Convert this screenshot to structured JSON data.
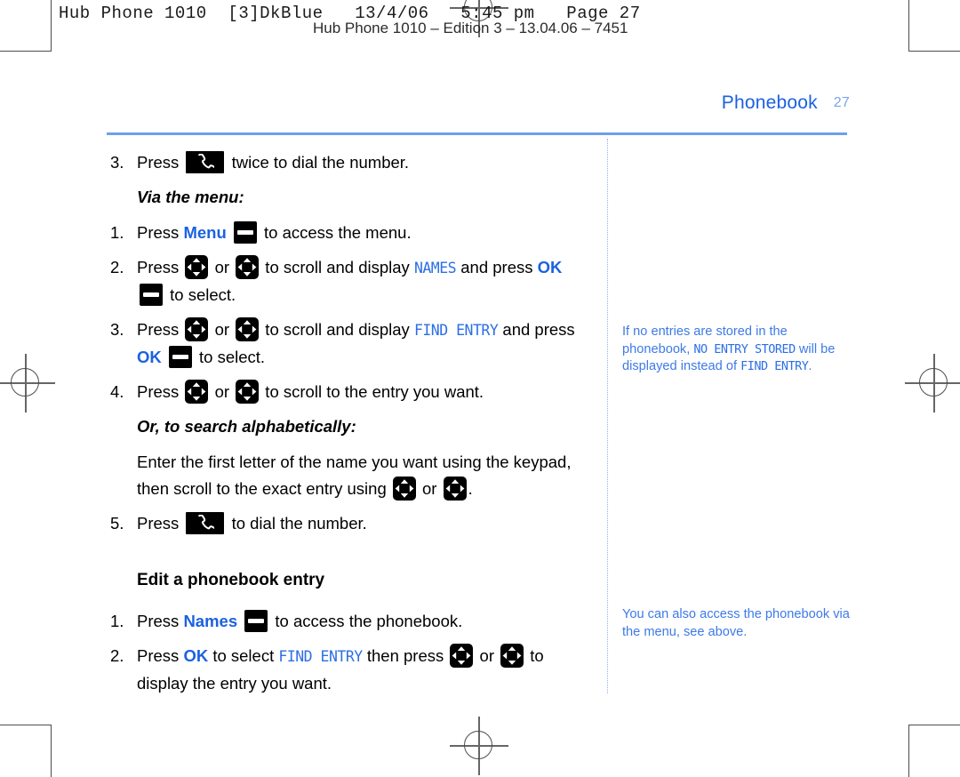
{
  "prepress": {
    "line1": "Hub Phone 1010  [3]DkBlue   13/4/06   5:45 pm   Page 27",
    "line2": "Hub Phone 1010 – Edition 3 – 13.04.06 – 7451"
  },
  "header": {
    "section_title": "Phonebook",
    "page_number": "27",
    "accent_color": "#1b62e0",
    "folio_color": "#7ba3e8",
    "rule_color": "#6f9fec"
  },
  "main": {
    "steps_dial": [
      {
        "num": "3.",
        "parts": [
          {
            "type": "text",
            "value": "Press "
          },
          {
            "type": "icon",
            "icon": "call-key-icon"
          },
          {
            "type": "text",
            "value": " twice to dial the number."
          }
        ]
      }
    ],
    "via_menu_label": "Via the menu:",
    "steps_menu": [
      {
        "num": "1.",
        "parts": [
          {
            "type": "text",
            "value": "Press "
          },
          {
            "type": "blue",
            "value": "Menu"
          },
          {
            "type": "text",
            "value": " "
          },
          {
            "type": "icon",
            "icon": "softkey-icon"
          },
          {
            "type": "text",
            "value": " to access the menu."
          }
        ]
      },
      {
        "num": "2.",
        "parts": [
          {
            "type": "text",
            "value": "Press "
          },
          {
            "type": "icon",
            "icon": "nav-key-icon"
          },
          {
            "type": "text",
            "value": " or "
          },
          {
            "type": "icon",
            "icon": "nav-key-icon"
          },
          {
            "type": "text",
            "value": " to scroll and display "
          },
          {
            "type": "lcd",
            "value": "NAMES"
          },
          {
            "type": "text",
            "value": " and press "
          },
          {
            "type": "blue",
            "value": "OK"
          },
          {
            "type": "text",
            "value": " "
          },
          {
            "type": "icon",
            "icon": "softkey-icon"
          },
          {
            "type": "text",
            "value": " to select."
          }
        ]
      },
      {
        "num": "3.",
        "parts": [
          {
            "type": "text",
            "value": "Press "
          },
          {
            "type": "icon",
            "icon": "nav-key-icon"
          },
          {
            "type": "text",
            "value": " or "
          },
          {
            "type": "icon",
            "icon": "nav-key-icon"
          },
          {
            "type": "text",
            "value": " to scroll and display "
          },
          {
            "type": "lcd",
            "value": "FIND ENTRY"
          },
          {
            "type": "text",
            "value": " and press "
          },
          {
            "type": "blue",
            "value": "OK"
          },
          {
            "type": "text",
            "value": " "
          },
          {
            "type": "icon",
            "icon": "softkey-icon"
          },
          {
            "type": "text",
            "value": " to select."
          }
        ]
      },
      {
        "num": "4.",
        "parts": [
          {
            "type": "text",
            "value": "Press "
          },
          {
            "type": "icon",
            "icon": "nav-key-icon"
          },
          {
            "type": "text",
            "value": " or "
          },
          {
            "type": "icon",
            "icon": "nav-key-icon"
          },
          {
            "type": "text",
            "value": " to scroll to the entry you want."
          }
        ]
      }
    ],
    "alpha_search_label": "Or, to search alphabetically:",
    "alpha_search_body": [
      {
        "type": "text",
        "value": "Enter the first letter of the name you want using the keypad, then scroll to the exact entry using "
      },
      {
        "type": "icon",
        "icon": "nav-key-icon"
      },
      {
        "type": "text",
        "value": " or "
      },
      {
        "type": "icon",
        "icon": "nav-key-icon"
      },
      {
        "type": "text",
        "value": "."
      }
    ],
    "steps_dial_final": [
      {
        "num": "5.",
        "parts": [
          {
            "type": "text",
            "value": "Press "
          },
          {
            "type": "icon",
            "icon": "call-key-icon"
          },
          {
            "type": "text",
            "value": " to dial the number."
          }
        ]
      }
    ],
    "edit_heading": "Edit a phonebook entry",
    "steps_edit": [
      {
        "num": "1.",
        "parts": [
          {
            "type": "text",
            "value": "Press "
          },
          {
            "type": "blue",
            "value": "Names"
          },
          {
            "type": "text",
            "value": " "
          },
          {
            "type": "icon",
            "icon": "softkey-icon"
          },
          {
            "type": "text",
            "value": " to access the phonebook."
          }
        ]
      },
      {
        "num": "2.",
        "parts": [
          {
            "type": "text",
            "value": "Press "
          },
          {
            "type": "blue",
            "value": "OK"
          },
          {
            "type": "text",
            "value": " to select "
          },
          {
            "type": "lcd",
            "value": "FIND ENTRY"
          },
          {
            "type": "text",
            "value": " then press "
          },
          {
            "type": "icon",
            "icon": "nav-key-icon"
          },
          {
            "type": "text",
            "value": " or "
          },
          {
            "type": "icon",
            "icon": "nav-key-icon"
          },
          {
            "type": "text",
            "value": " to display the entry you want."
          }
        ]
      }
    ]
  },
  "side_notes": [
    {
      "name": "note-no-entry-stored",
      "parts": [
        {
          "type": "text",
          "value": "If no entries are stored in the phonebook, "
        },
        {
          "type": "lcd",
          "value": "NO ENTRY STORED"
        },
        {
          "type": "text",
          "value": " will be displayed instead of "
        },
        {
          "type": "lcd",
          "value": "FIND ENTRY"
        },
        {
          "type": "text",
          "value": "."
        }
      ]
    },
    {
      "name": "note-access-via-menu",
      "parts": [
        {
          "type": "text",
          "value": "You can also access the phonebook via the menu, see above."
        }
      ]
    }
  ],
  "icons": {
    "call-key-icon": "call-key-icon",
    "softkey-icon": "softkey-icon",
    "nav-key-icon": "nav-key-icon"
  }
}
